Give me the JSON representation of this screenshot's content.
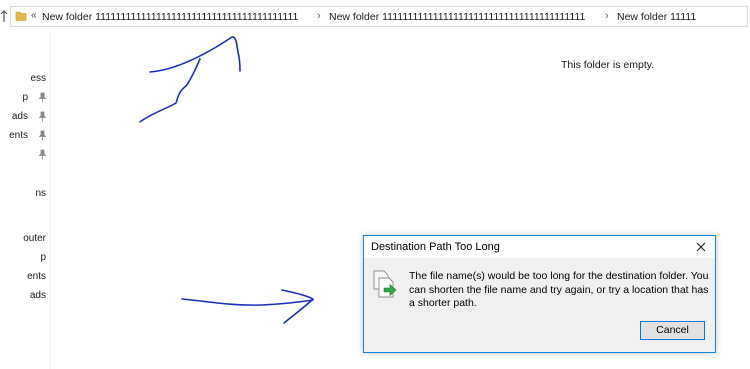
{
  "address_bar": {
    "overflow_glyph": "«",
    "separator_glyph": "›",
    "breadcrumbs": [
      "New folder 1111111111111111111111111111111111111111",
      "New folder 1111111111111111111111111111111111111111",
      "New folder 11111"
    ]
  },
  "nav_pane": {
    "items": [
      {
        "label": "ess",
        "pinned": false
      },
      {
        "label": "p",
        "pinned": true
      },
      {
        "label": "ads",
        "pinned": true
      },
      {
        "label": "ents",
        "pinned": true
      },
      {
        "label": "",
        "pinned": true
      },
      {
        "label": "ns",
        "pinned": false
      },
      {
        "label": "outer",
        "pinned": false
      },
      {
        "label": "p",
        "pinned": false
      },
      {
        "label": "ents",
        "pinned": false
      },
      {
        "label": "ads",
        "pinned": false
      }
    ]
  },
  "content": {
    "empty_message": "This folder is empty."
  },
  "dialog": {
    "title": "Destination Path Too Long",
    "message": "The file name(s) would be too long for the destination folder. You can shorten the file name and try again, or try a location that has a shorter path.",
    "cancel_label": "Cancel"
  },
  "colors": {
    "accent": "#0078d7",
    "ink": "#1a2fbf",
    "folder": "#e8b44a"
  }
}
